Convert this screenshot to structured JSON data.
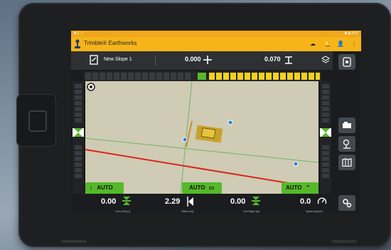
{
  "app": {
    "title": "Trimble® Earthworks"
  },
  "status_bar": {
    "left": "■ 1 ⚡",
    "right": "◉ ▮ 3:57"
  },
  "toolbar": {
    "design_name": "New Slope 1",
    "cut_fill_value": "0.000",
    "slope_value": "0.070"
  },
  "map": {
    "auto_left": "AUTO",
    "auto_center": "AUTO",
    "auto_right": "AUTO"
  },
  "bottom": {
    "cut_left_value": "0.00",
    "cut_left_label": "Cut Left [m]",
    "offset_value": "2.29",
    "offset_label": "Offset [m]",
    "cut_right_value": "0.00",
    "cut_right_label": "Cut Right [m]",
    "speed_value": "0.0",
    "speed_label": "Speed [km/h]"
  },
  "icons": {
    "menu": "kebab-menu-icon",
    "bell": "bell-icon",
    "user": "user-icon",
    "cloud": "cloud-icon"
  },
  "colors": {
    "brand_yellow": "#f6b418",
    "grade_green": "#55b92a",
    "cut_line": "#d9261c",
    "grade_yellow": "#f3d21e"
  }
}
